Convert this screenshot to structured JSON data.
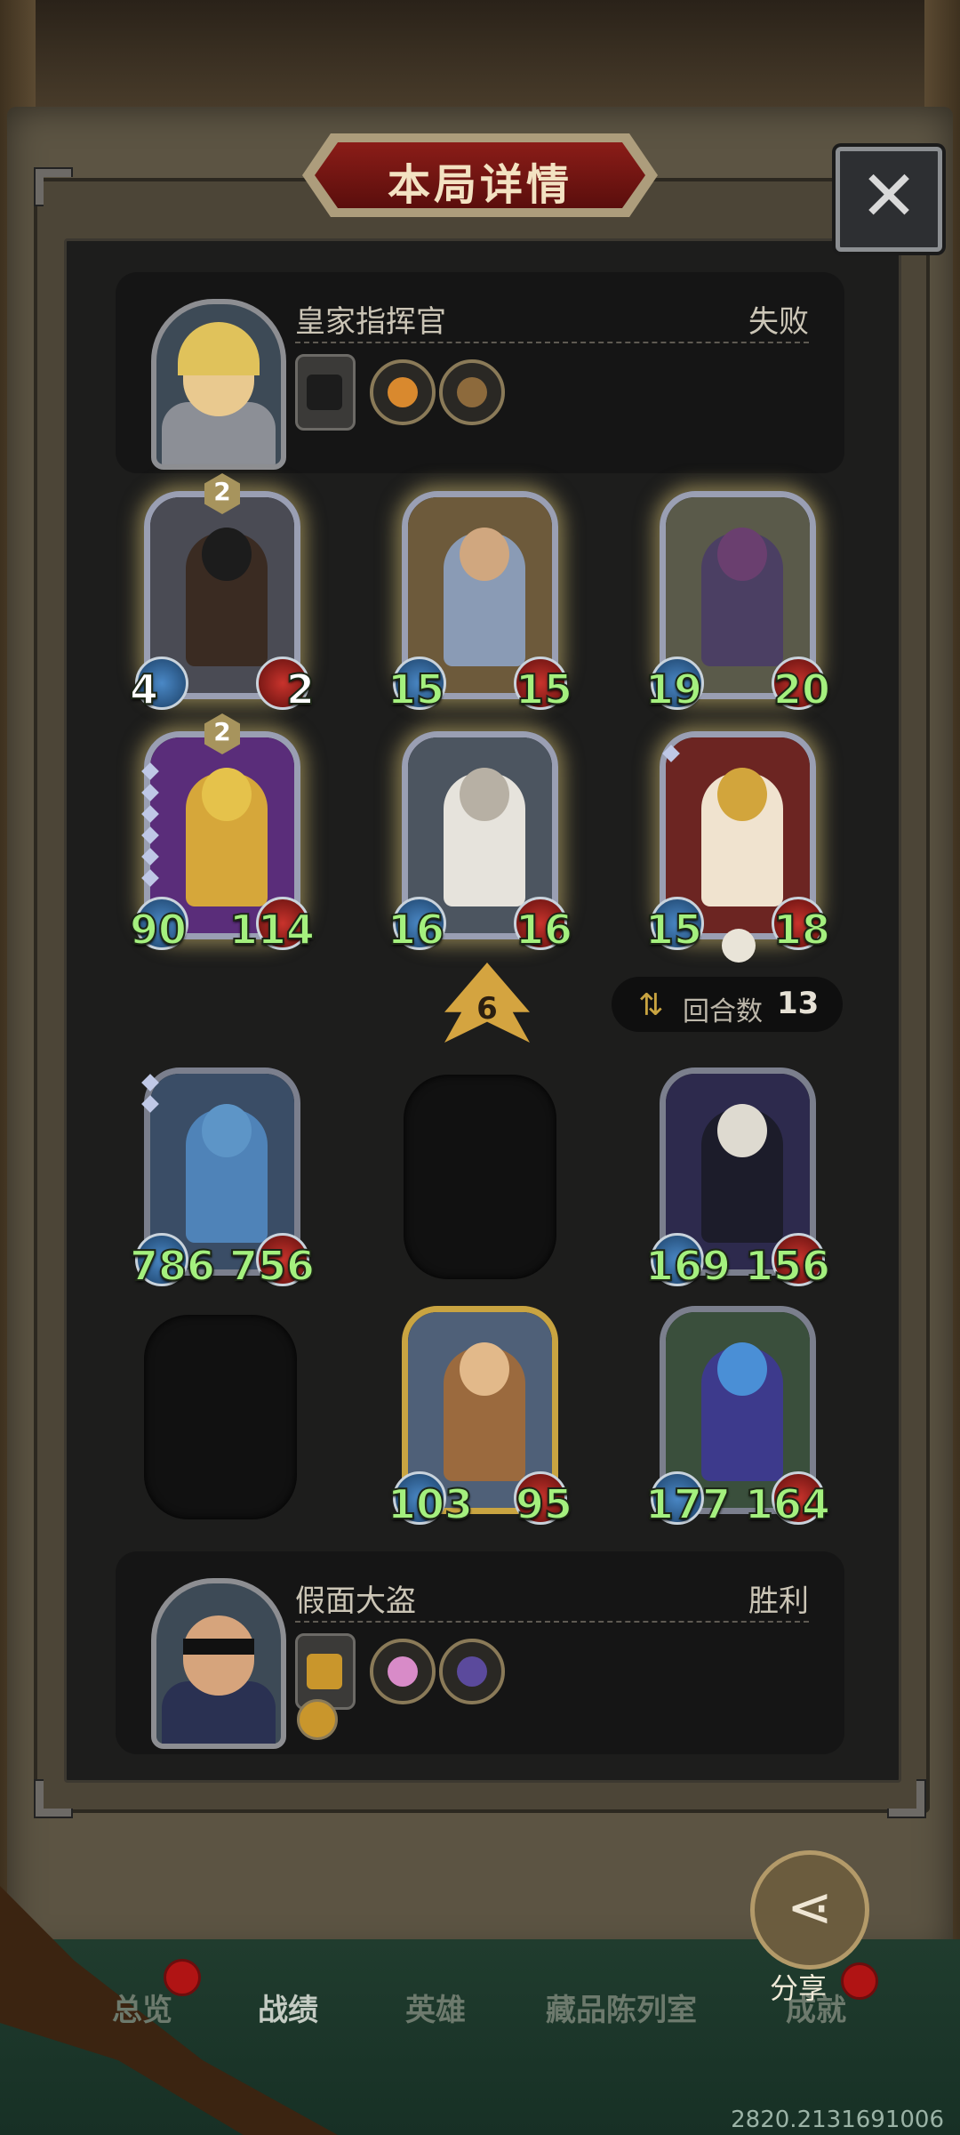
{
  "header": {
    "title": "本局详情"
  },
  "opponent": {
    "name": "皇家指挥官",
    "result": "失败"
  },
  "player": {
    "name": "假面大盗",
    "result": "胜利"
  },
  "opponent_board": [
    {
      "atk": "4",
      "hp": "2",
      "star": "2",
      "green": false
    },
    {
      "atk": "15",
      "hp": "15",
      "green": true
    },
    {
      "atk": "19",
      "hp": "20",
      "green": true
    },
    {
      "atk": "90",
      "hp": "114",
      "star": "2",
      "green": true
    },
    {
      "atk": "16",
      "hp": "16",
      "green": true
    },
    {
      "atk": "15",
      "hp": "18",
      "green": true
    }
  ],
  "player_board": [
    {
      "atk": "786",
      "hp": "756"
    },
    {
      "atk": "169",
      "hp": "156"
    },
    {
      "atk": "103",
      "hp": "95"
    },
    {
      "atk": "177",
      "hp": "164"
    }
  ],
  "level": "6",
  "rounds": {
    "label": "回合数",
    "value": "13"
  },
  "share": {
    "label": "分享"
  },
  "nav": {
    "overview": "总览",
    "record": "战绩",
    "heroes": "英雄",
    "collection": "藏品陈列室",
    "achievements": "成就"
  },
  "uid": "2820.2131691006",
  "icons": [
    "close-icon",
    "share-icon",
    "round-swap-icon",
    "level-arrow-icon",
    "crown-icon"
  ],
  "colors": {
    "stat_green": "#a4f07e",
    "panel": "#1d1d1c",
    "gold": "#c9a441",
    "title_red": "#8b1d18"
  }
}
